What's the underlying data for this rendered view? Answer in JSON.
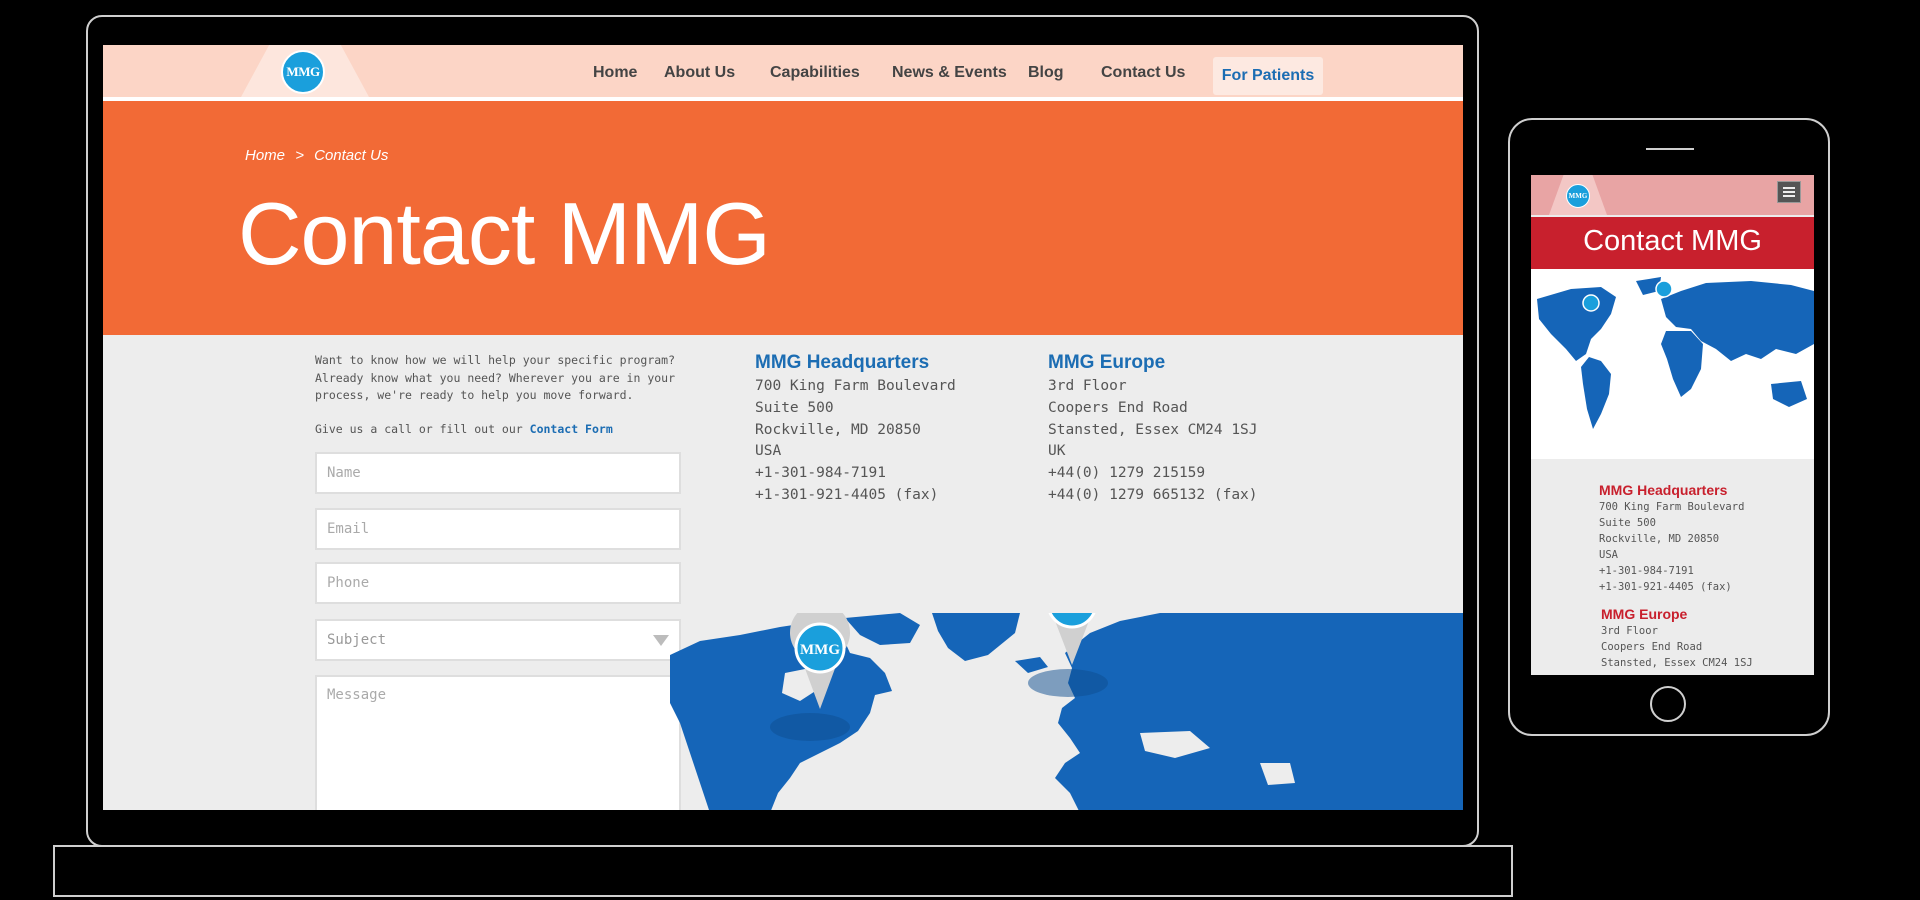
{
  "brand": {
    "logo_text": "MMG"
  },
  "nav": {
    "items": [
      "Home",
      "About Us",
      "Capabilities",
      "News & Events",
      "Blog",
      "Contact Us"
    ],
    "patients_label": "For Patients"
  },
  "breadcrumb": {
    "home": "Home",
    "separator": ">",
    "current": "Contact Us"
  },
  "hero": {
    "title": "Contact MMG"
  },
  "intro": {
    "text": "Want to know how we will help your specific program? Already know what you need? Wherever you are in your process, we're ready to help you move forward.",
    "cta_prefix": "Give us a call or fill out our",
    "cta_link": "Contact Form"
  },
  "form": {
    "name_placeholder": "Name",
    "email_placeholder": "Email",
    "phone_placeholder": "Phone",
    "subject_placeholder": "Subject",
    "message_placeholder": "Message"
  },
  "offices": {
    "hq": {
      "title": "MMG Headquarters",
      "lines": [
        "700 King Farm Boulevard",
        "Suite 500",
        "Rockville, MD 20850",
        "USA",
        "+1-301-984-7191",
        "+1-301-921-4405 (fax)"
      ]
    },
    "europe": {
      "title": "MMG Europe",
      "lines": [
        "3rd Floor",
        "Coopers End Road",
        "Stansted, Essex CM24 1SJ",
        "UK",
        "+44(0) 1279 215159",
        "+44(0) 1279 665132 (fax)"
      ]
    }
  },
  "mobile": {
    "logo_text": "MMG",
    "title": "Contact MMG",
    "hq_title": "MMG Headquarters",
    "hq_lines": [
      "700 King Farm Boulevard",
      "Suite 500",
      "Rockville, MD 20850",
      "USA",
      "+1-301-984-7191",
      "+1-301-921-4405 (fax)"
    ],
    "europe_title": "MMG Europe",
    "europe_lines": [
      "3rd Floor",
      "Coopers End Road",
      "Stansted, Essex CM24 1SJ"
    ]
  },
  "colors": {
    "hero": "#f26a36",
    "nav": "#fcd5c6",
    "link": "#1c6db3",
    "map": "#1565b8",
    "pin": "#1a9fdc",
    "mobile_hero": "#c8202d"
  }
}
